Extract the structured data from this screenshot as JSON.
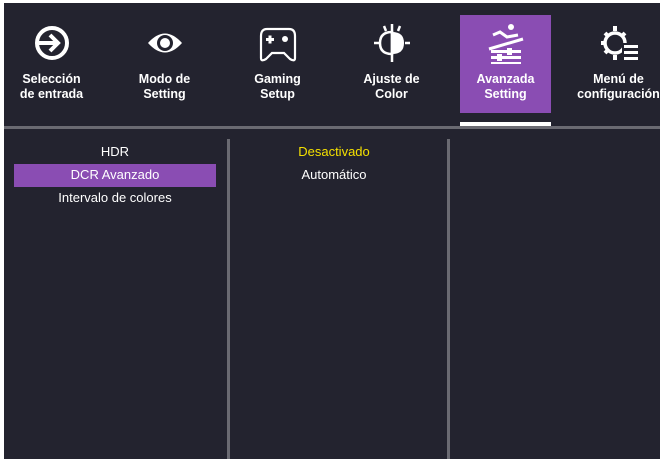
{
  "tabs": [
    {
      "line1": "Selección",
      "line2": "de entrada",
      "icon": "input-source-icon",
      "active": false
    },
    {
      "line1": "Modo de",
      "line2": "Setting",
      "icon": "eye-icon",
      "active": false
    },
    {
      "line1": "Gaming",
      "line2": "Setup",
      "icon": "gamepad-icon",
      "active": false
    },
    {
      "line1": "Ajuste de",
      "line2": "Color",
      "icon": "color-adjust-icon",
      "active": false
    },
    {
      "line1": "Avanzada",
      "line2": "Setting",
      "icon": "advanced-settings-icon",
      "active": true
    },
    {
      "line1": "Menú de",
      "line2": "configuración",
      "icon": "gear-menu-icon",
      "active": false
    }
  ],
  "menu": {
    "items": [
      "HDR",
      "DCR Avanzado",
      "Intervalo de colores"
    ],
    "selected_index": 1
  },
  "options": {
    "items": [
      "Desactivado",
      "Automático"
    ],
    "current_index": 0
  },
  "colors": {
    "background": "#23232f",
    "accent": "#8a4db3",
    "current_value": "#f4e000",
    "divider": "#6a6a72"
  }
}
